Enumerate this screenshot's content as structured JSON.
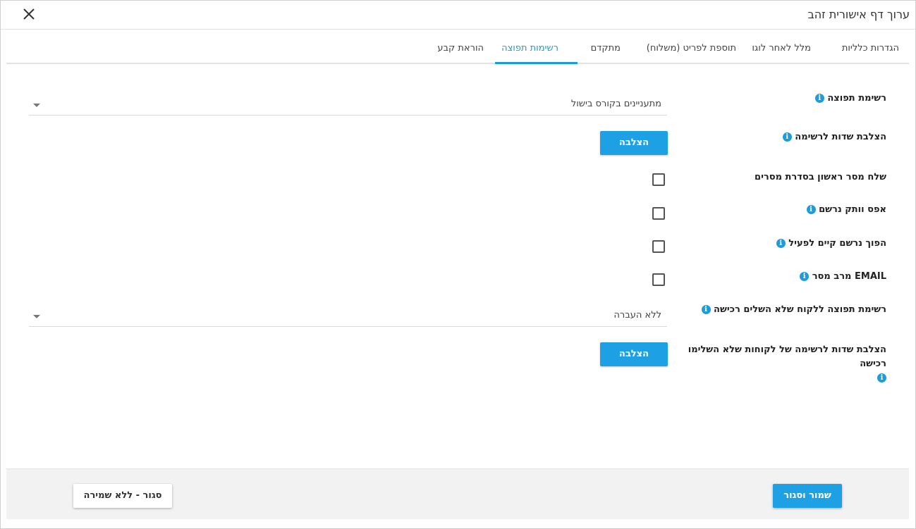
{
  "dialog": {
    "title": "ערוך דף אישורית זהב",
    "close_icon": "close-icon"
  },
  "tabs": [
    {
      "label": "הגדרות כלליות"
    },
    {
      "label": "מלל לאחר לוגו"
    },
    {
      "label": "תוספת לפריט (משלוח)"
    },
    {
      "label": "מתקדם"
    },
    {
      "label": "רשימות תפוצה",
      "active": true
    },
    {
      "label": "הוראת קבע"
    }
  ],
  "form": {
    "mailing_list": {
      "label": "רשימת תפוצה",
      "value": "מתעניינים בקורס בישול"
    },
    "list_fields": {
      "label": "הצלבת שדות לרשימה",
      "button": "הצלבה"
    },
    "send_first_message": {
      "label": "שלח מסר ראשון בסדרת מסרים",
      "checked": false
    },
    "reset_registered": {
      "label": "אפס וותק נרשם",
      "checked": false
    },
    "reactivate": {
      "label": "הפוך נרשם קיים לפעיל",
      "checked": false
    },
    "email_multi": {
      "label": "EMAIL מרב מסר",
      "checked": false
    },
    "incomplete_list": {
      "label": "רשימת תפוצה ללקוח שלא השלים רכישה",
      "value": "ללא העברה"
    },
    "incomplete_fields": {
      "label": "הצלבת שדות לרשימה של לקוחות שלא השלימו רכישה",
      "button": "הצלבה"
    }
  },
  "footer": {
    "save_label": "שמור וסגור",
    "close_label": "סגור - ללא שמירה"
  },
  "colors": {
    "accent": "#1ea1e4",
    "tab_active": "#1f9bd7"
  }
}
